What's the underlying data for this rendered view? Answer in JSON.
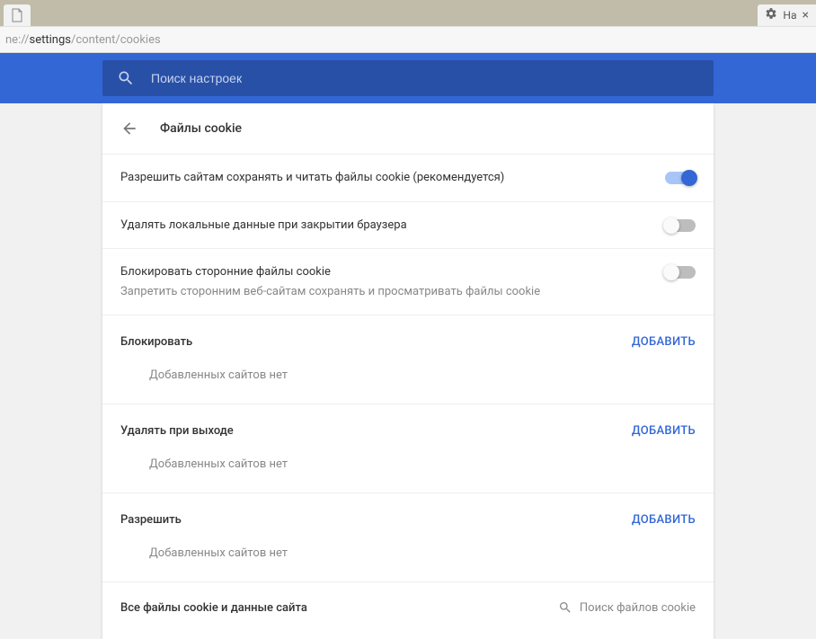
{
  "browser": {
    "tab_right_label": "На",
    "url_prefix": "ne://",
    "url_bold": "settings",
    "url_rest": "/content/cookies"
  },
  "header": {
    "search_placeholder": "Поиск настроек"
  },
  "page": {
    "title": "Файлы cookie"
  },
  "settings": [
    {
      "label": "Разрешить сайтам сохранять и читать файлы cookie (рекомендуется)",
      "sub": "",
      "on": true
    },
    {
      "label": "Удалять локальные данные при закрытии браузера",
      "sub": "",
      "on": false
    },
    {
      "label": "Блокировать сторонние файлы cookie",
      "sub": "Запретить сторонним веб-сайтам сохранять и просматривать файлы cookie",
      "on": false
    }
  ],
  "sections": [
    {
      "title": "Блокировать",
      "add": "ДОБАВИТЬ",
      "empty": "Добавленных сайтов нет"
    },
    {
      "title": "Удалять при выходе",
      "add": "ДОБАВИТЬ",
      "empty": "Добавленных сайтов нет"
    },
    {
      "title": "Разрешить",
      "add": "ДОБАВИТЬ",
      "empty": "Добавленных сайтов нет"
    }
  ],
  "footer": {
    "all_cookies": "Все файлы cookie и данные сайта",
    "cookie_search_placeholder": "Поиск файлов cookie"
  }
}
